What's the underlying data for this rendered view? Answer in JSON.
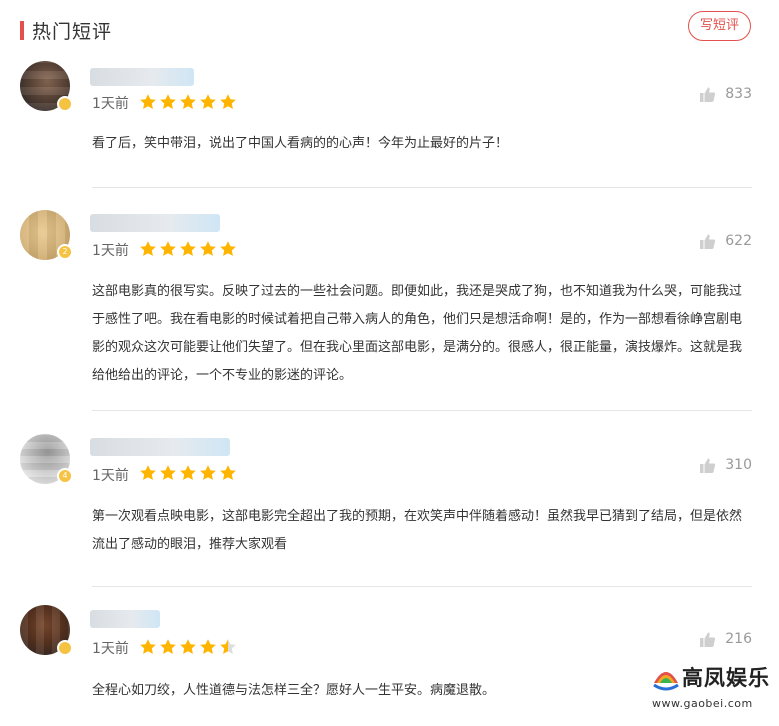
{
  "header": {
    "title": "热门短评",
    "write_button": "写短评"
  },
  "reviews": [
    {
      "avatar_badge": "",
      "time": "1天前",
      "rating": 5,
      "likes": "833",
      "content": "看了后，笑中带泪，说出了中国人看病的的心声！今年为止最好的片子！"
    },
    {
      "avatar_badge": "2",
      "time": "1天前",
      "rating": 5,
      "likes": "622",
      "content": "这部电影真的很写实。反映了过去的一些社会问题。即便如此，我还是哭成了狗，也不知道我为什么哭，可能我过于感性了吧。我在看电影的时候试着把自己带入病人的角色，他们只是想活命啊！是的，作为一部想看徐峥宫剧电影的观众这次可能要让他们失望了。但在我心里面这部电影，是满分的。很感人，很正能量，演技爆炸。这就是我给他给出的评论，一个不专业的影迷的评论。"
    },
    {
      "avatar_badge": "4",
      "time": "1天前",
      "rating": 5,
      "likes": "310",
      "content": "第一次观看点映电影，这部电影完全超出了我的预期，在欢笑声中伴随着感动！虽然我早已猜到了结局，但是依然流出了感动的眼泪，推荐大家观看"
    },
    {
      "avatar_badge": "",
      "time": "1天前",
      "rating": 4.5,
      "likes": "216",
      "content": "全程心如刀绞，人性道德与法怎样三全？愿好人一生平安。病魔退散。"
    }
  ],
  "watermark": {
    "brand": "高凤娱乐",
    "url": "www.gaobei.com"
  },
  "colors": {
    "accent": "#e2514c",
    "star": "#ffb400",
    "star_empty": "#dddddd",
    "muted": "#999999"
  },
  "icons": {
    "like": "thumbs-up-icon",
    "star": "star-icon"
  }
}
